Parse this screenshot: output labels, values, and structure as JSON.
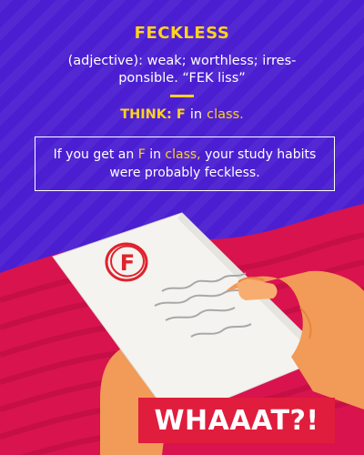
{
  "card": {
    "word": "FECKLESS",
    "definition": "(adjective): weak; worthless; irres-ponsible. “FEK liss”",
    "think": {
      "label": "THINK:",
      "letter": "F",
      "connector": "in",
      "word": "class."
    },
    "example": {
      "before": "If you get an",
      "letter": "F",
      "connector": "in",
      "emph": "class,",
      "after": "your study habits were probably feckless."
    },
    "grade": "F",
    "exclaim": "WHAAAT?!"
  },
  "colors": {
    "background": "#4b1fd1",
    "accent": "#ffd21f",
    "wave": "#d8134e",
    "exclaim_bg": "#e01d3c",
    "grade_red": "#e0222c"
  }
}
